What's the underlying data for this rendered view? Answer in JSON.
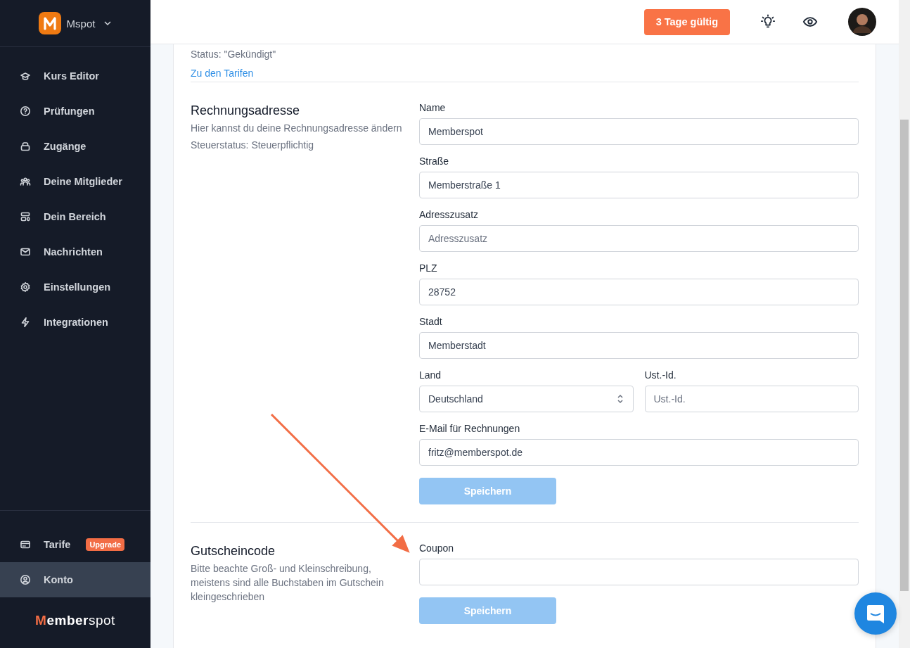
{
  "workspace": {
    "name": "Mspot"
  },
  "sidebar": {
    "items": [
      {
        "label": "Kurs Editor",
        "selected": false
      },
      {
        "label": "Prüfungen",
        "selected": false
      },
      {
        "label": "Zugänge",
        "selected": false
      },
      {
        "label": "Deine Mitglieder",
        "selected": false
      },
      {
        "label": "Dein Bereich",
        "selected": false
      },
      {
        "label": "Nachrichten",
        "selected": false
      },
      {
        "label": "Einstellungen",
        "selected": false
      },
      {
        "label": "Integrationen",
        "selected": false
      }
    ],
    "bottom_items": [
      {
        "label": "Tarife",
        "badge": "Upgrade",
        "selected": false
      },
      {
        "label": "Konto",
        "selected": true
      }
    ],
    "logo": {
      "accent": "M",
      "rest_bold": "ember",
      "rest": "spot"
    }
  },
  "header": {
    "trial_button": "3 Tage gültig"
  },
  "plan": {
    "status": "Status: \"Gekündigt\"",
    "link": "Zu den Tarifen"
  },
  "billing": {
    "title": "Rechnungsadresse",
    "description": "Hier kannst du deine Rechnungsadresse ändern",
    "tax_status": "Steuerstatus: Steuerpflichtig",
    "fields": [
      {
        "label": "Name",
        "value": "Memberspot",
        "kind": "text"
      },
      {
        "label": "Straße",
        "value": "Memberstraße 1",
        "kind": "text"
      },
      {
        "label": "Adresszusatz",
        "placeholder": "Adresszusatz",
        "kind": "text"
      },
      {
        "label": "PLZ",
        "value": "28752",
        "kind": "text"
      },
      {
        "label": "Stadt",
        "value": "Memberstadt",
        "kind": "text"
      },
      {
        "kind": "row",
        "fields": [
          {
            "label": "Land",
            "value": "Deutschland",
            "kind": "select"
          },
          {
            "label": "Ust.-Id.",
            "placeholder": "Ust.-Id.",
            "kind": "text"
          }
        ]
      },
      {
        "label": "E-Mail für Rechnungen",
        "value": "fritz@memberspot.de",
        "kind": "text"
      }
    ],
    "save_button": {
      "label": "Speichern",
      "disabled": true
    }
  },
  "coupon": {
    "title": "Gutscheincode",
    "description": "Bitte beachte Groß- und Kleinschreibung, meistens sind alle Buchstaben im Gutschein kleingeschrieben",
    "fields": [
      {
        "label": "Coupon",
        "kind": "text"
      }
    ],
    "save_button": {
      "label": "Speichern",
      "disabled": true
    }
  }
}
